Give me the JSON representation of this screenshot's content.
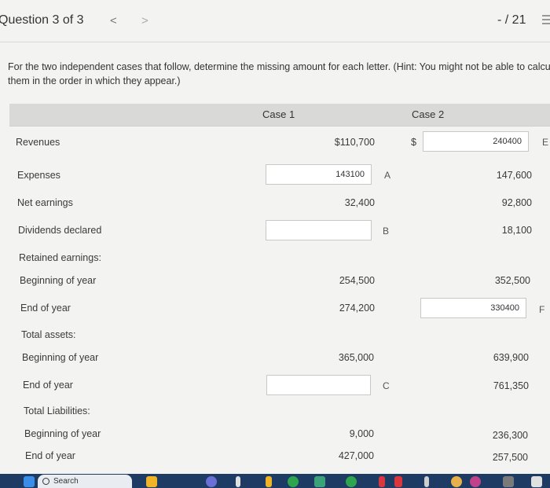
{
  "header": {
    "question_label": "Question 3 of 3",
    "prev_glyph": "<",
    "next_glyph": ">",
    "score": "- / 21"
  },
  "instructions": {
    "line1": "For the two independent cases that follow, determine the missing amount for each letter. (Hint: You might not be able to calcul",
    "line2": "them in the order in which they appear.)"
  },
  "table": {
    "case1_header": "Case 1",
    "case2_header": "Case 2",
    "rows": {
      "revenues": {
        "label": "Revenues",
        "case1": "$110,700",
        "case2_prefix": "$",
        "case2_input": "240400",
        "case2_letter": "E"
      },
      "expenses": {
        "label": "Expenses",
        "case1_input": "143100",
        "case1_letter": "A",
        "case2": "147,600"
      },
      "net_earnings": {
        "label": "Net earnings",
        "case1": "32,400",
        "case2": "92,800"
      },
      "dividends": {
        "label": "Dividends declared",
        "case1_input": "",
        "case1_letter": "B",
        "case2": "18,100"
      },
      "retained_heading": {
        "label": "Retained earnings:"
      },
      "re_beginning": {
        "label": "Beginning of year",
        "case1": "254,500",
        "case2": "352,500"
      },
      "re_end": {
        "label": "End of year",
        "case1": "274,200",
        "case2_input": "330400",
        "case2_letter": "F"
      },
      "assets_heading": {
        "label": "Total assets:"
      },
      "ta_beginning": {
        "label": "Beginning of year",
        "case1": "365,000",
        "case2": "639,900"
      },
      "ta_end": {
        "label": "End of year",
        "case1_input": "",
        "case1_letter": "C",
        "case2": "761,350"
      },
      "liab_heading": {
        "label": "Total Liabilities:"
      },
      "tl_beginning": {
        "label": "Beginning of year",
        "case1": "9,000",
        "case2": "236,300"
      },
      "tl_end": {
        "label": "End of year",
        "case1": "427,000",
        "case2": "257,500"
      }
    }
  },
  "taskbar": {
    "search_label": "Search",
    "colors": {
      "bar": "#1e3b63",
      "start": "#3b8ee8",
      "accent1": "#f0b429",
      "accent2": "#2ea44f",
      "accent3": "#d9363e"
    }
  }
}
